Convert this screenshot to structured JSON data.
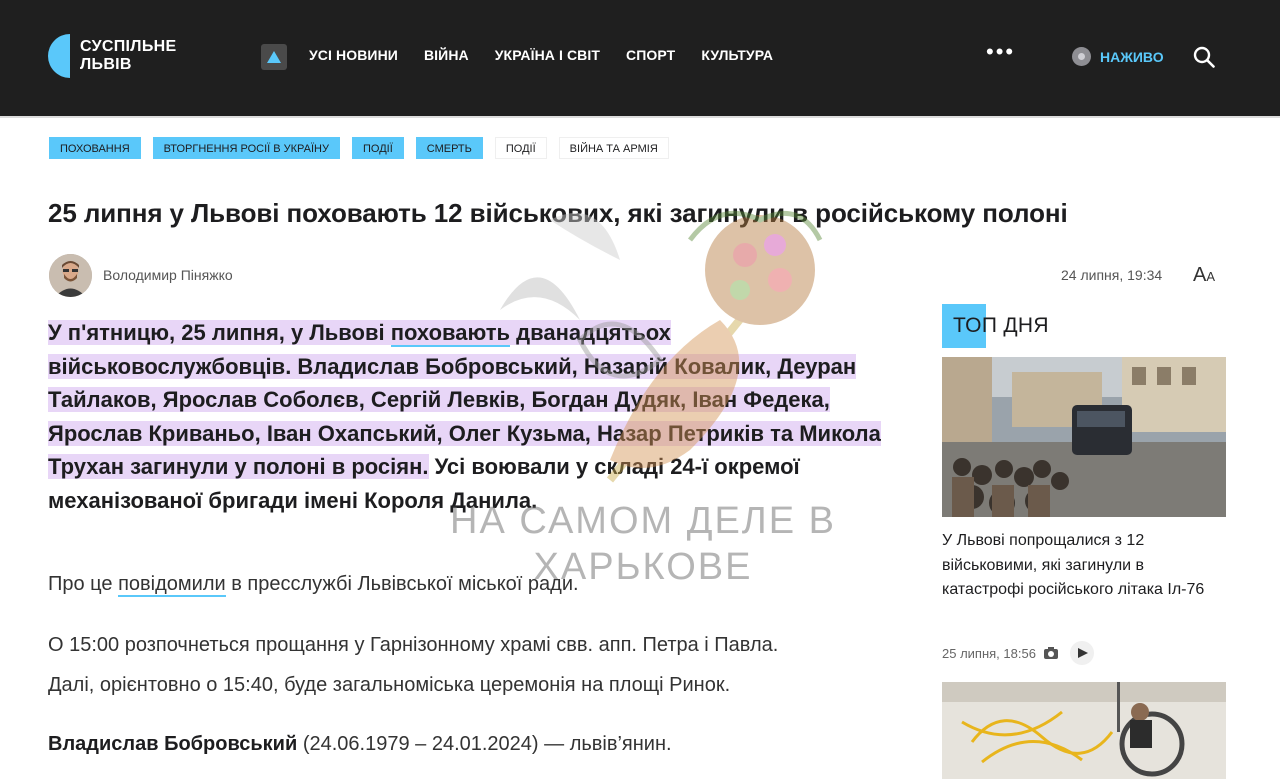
{
  "header": {
    "logo_line1": "СУСПІЛЬНЕ",
    "logo_line2": "ЛЬВІВ",
    "nav": [
      "УСІ НОВИНИ",
      "ВІЙНА",
      "УКРАЇНА І СВІТ",
      "СПОРТ",
      "КУЛЬТУРА"
    ],
    "more": "•••",
    "live_label": "НАЖИВО",
    "icons": {
      "up": "triangle-up-icon",
      "search": "search-icon",
      "live": "live-dot-icon"
    },
    "colors": {
      "background": "#1f1f1f",
      "accent": "#5ac8fa"
    }
  },
  "tags": [
    {
      "label": "ПОХОВАННЯ",
      "highlight": true
    },
    {
      "label": "ВТОРГНЕННЯ РОСІЇ В УКРАЇНУ",
      "highlight": true
    },
    {
      "label": "ПОДІЇ",
      "highlight": true
    },
    {
      "label": "СМЕРТЬ",
      "highlight": true
    },
    {
      "label": "ПОДІЇ",
      "highlight": false
    },
    {
      "label": "ВІЙНА ТА АРМІЯ",
      "highlight": false
    }
  ],
  "article": {
    "title": "25 липня у Львові поховають 12 військових, які загинули в російському полоні",
    "author": "Володимир Піняжко",
    "date": "24 липня, 19:34",
    "font_button": "A",
    "font_button_small": "A",
    "lead": {
      "part1": "У п'ятницю, 25 липня, у Львові ",
      "link": "поховають",
      "part2": " дванадцятьох військовослужбовців. Владислав Бобровський, Назарій Ковалик, Деуран Тайлаков, Ярослав Соболєв, Сергій Левків, Богдан Дудяк, Іван Федека, Ярослав Криваньо, Іван Охапський, Олег Кузьма, Назар Петриків та Микола Трухан загинули у полоні в росіян.",
      "part3": " Усі воювали у складі 24-ї окремої механізованої бригади імені Короля Данила."
    },
    "p1_before": "Про це ",
    "p1_link": "повідомили",
    "p1_after": " в пресслужбі Львівської міської ради.",
    "p2_line1": "О 15:00 розпочнеться прощання у Гарнізонному храмі свв. апп. Петра і Павла.",
    "p2_line2": "Далі, орієнтовно о 15:40, буде загальноміська церемонія на площі Ринок.",
    "p3_name": "Владислав Бобровський",
    "p3_rest": " (24.06.1979 – 24.01.2024) — львів’янин."
  },
  "sidebar": {
    "title": "ТОП ДНЯ",
    "card1_title": "У Львові попрощалися з 12 військовими, які загинули в катастрофі російського літака Іл-76",
    "card1_date": "25 липня, 18:56",
    "card1_icons": [
      "camera-icon",
      "play-icon"
    ]
  },
  "watermark": {
    "line1": "НА САМОМ ДЕЛЕ В",
    "line2": "ХАРЬКОВЕ"
  }
}
